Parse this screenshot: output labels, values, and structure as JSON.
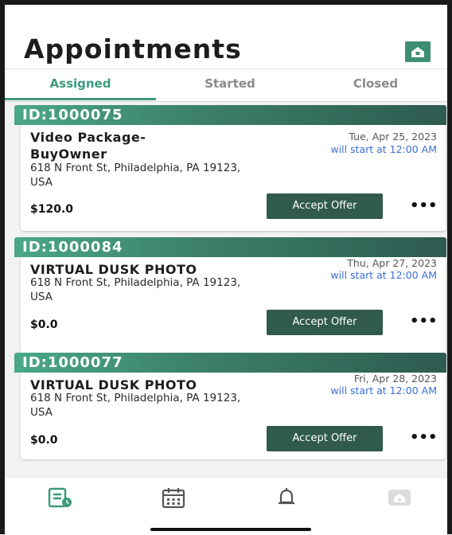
{
  "header": {
    "title": "Appointments",
    "home_icon": "home-icon",
    "accent": "#3d8f74"
  },
  "tabs": [
    {
      "label": "Assigned",
      "active": true
    },
    {
      "label": "Started",
      "active": false
    },
    {
      "label": "Closed",
      "active": false
    }
  ],
  "appointments": [
    {
      "id": "ID:1000075",
      "service": "Video Package-BuyOwner",
      "address": "618 N Front St, Philadelphia, PA 19123, USA",
      "date": "Tue, Apr 25, 2023",
      "start": "will start at  12:00 AM",
      "price": "$120.0",
      "accept_label": "Accept Offer",
      "more_label": "•••"
    },
    {
      "id": "ID:1000084",
      "service": "VIRTUAL DUSK PHOTO",
      "address": "618 N Front St, Philadelphia, PA 19123, USA",
      "date": "Thu, Apr 27, 2023",
      "start": "will start at  12:00 AM",
      "price": "$0.0",
      "accept_label": "Accept Offer",
      "more_label": "•••"
    },
    {
      "id": "ID:1000077",
      "service": "VIRTUAL DUSK PHOTO",
      "address": "618 N Front St, Philadelphia, PA 19123, USA",
      "date": "Fri, Apr 28, 2023",
      "start": "will start at  12:00 AM",
      "price": "$0.0",
      "accept_label": "Accept Offer",
      "more_label": "•••"
    }
  ],
  "bottom_nav": [
    {
      "icon": "appointments-list-icon",
      "active": true
    },
    {
      "icon": "calendar-icon",
      "active": false
    },
    {
      "icon": "bell-icon",
      "active": false
    },
    {
      "icon": "home-icon",
      "active": false
    }
  ],
  "colors": {
    "active_tab": "#3c9b7d",
    "button": "#2f5a4d",
    "start_text": "#3a6fd8"
  }
}
